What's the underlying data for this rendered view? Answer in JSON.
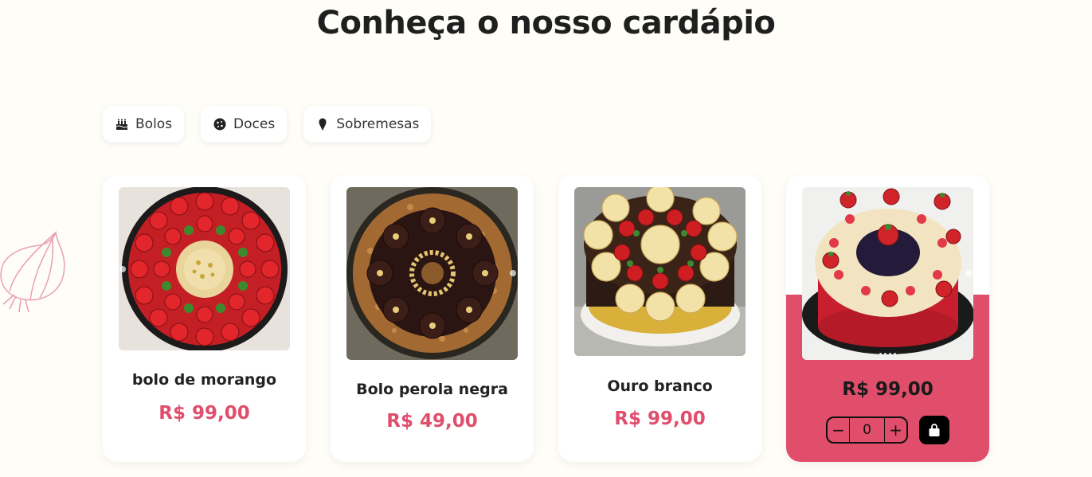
{
  "section": {
    "title": "Conheça o nosso cardápio"
  },
  "categories": [
    {
      "label": "Bolos",
      "icon": "birthday-cake-icon"
    },
    {
      "label": "Doces",
      "icon": "cookie-icon"
    },
    {
      "label": "Sobremesas",
      "icon": "ice-cream-icon"
    }
  ],
  "products": [
    {
      "name": "bolo de morango",
      "price": "R$ 99,00"
    },
    {
      "name": "Bolo perola negra",
      "price": "R$ 49,00"
    },
    {
      "name": "Ouro branco",
      "price": "R$ 99,00"
    },
    {
      "name": "",
      "price": "R$ 99,00",
      "quantity": "0",
      "minus": "−",
      "plus": "+"
    }
  ],
  "colors": {
    "accent": "#e04e6c",
    "background": "#fffdf7",
    "card": "#ffffff"
  }
}
